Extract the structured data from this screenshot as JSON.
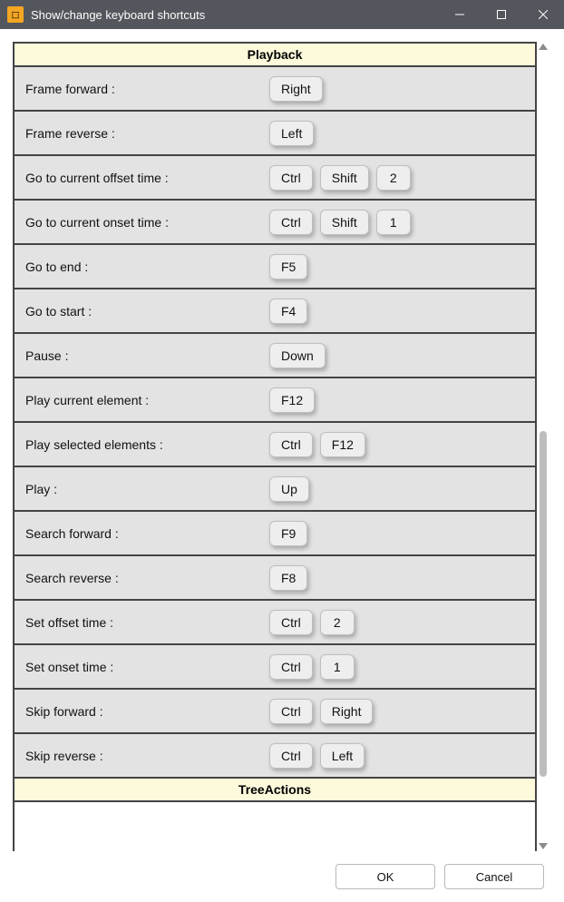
{
  "window": {
    "title": "Show/change keyboard shortcuts"
  },
  "sections": {
    "playback": {
      "title": "Playback"
    },
    "treeactions": {
      "title": "TreeActions"
    }
  },
  "rows": {
    "frame_forward": {
      "label": "Frame forward :",
      "keys": [
        "Right"
      ]
    },
    "frame_reverse": {
      "label": "Frame reverse :",
      "keys": [
        "Left"
      ]
    },
    "goto_offset": {
      "label": "Go to current offset time :",
      "keys": [
        "Ctrl",
        "Shift",
        "2"
      ]
    },
    "goto_onset": {
      "label": "Go to current onset time :",
      "keys": [
        "Ctrl",
        "Shift",
        "1"
      ]
    },
    "goto_end": {
      "label": "Go to end :",
      "keys": [
        "F5"
      ]
    },
    "goto_start": {
      "label": "Go to start :",
      "keys": [
        "F4"
      ]
    },
    "pause": {
      "label": "Pause :",
      "keys": [
        "Down"
      ]
    },
    "play_current": {
      "label": "Play current element :",
      "keys": [
        "F12"
      ]
    },
    "play_selected": {
      "label": "Play selected elements :",
      "keys": [
        "Ctrl",
        "F12"
      ]
    },
    "play": {
      "label": "Play :",
      "keys": [
        "Up"
      ]
    },
    "search_forward": {
      "label": "Search forward :",
      "keys": [
        "F9"
      ]
    },
    "search_reverse": {
      "label": "Search reverse :",
      "keys": [
        "F8"
      ]
    },
    "set_offset": {
      "label": "Set offset time :",
      "keys": [
        "Ctrl",
        "2"
      ]
    },
    "set_onset": {
      "label": "Set onset time :",
      "keys": [
        "Ctrl",
        "1"
      ]
    },
    "skip_forward": {
      "label": "Skip forward :",
      "keys": [
        "Ctrl",
        "Right"
      ]
    },
    "skip_reverse": {
      "label": "Skip reverse :",
      "keys": [
        "Ctrl",
        "Left"
      ]
    }
  },
  "footer": {
    "ok": "OK",
    "cancel": "Cancel"
  }
}
